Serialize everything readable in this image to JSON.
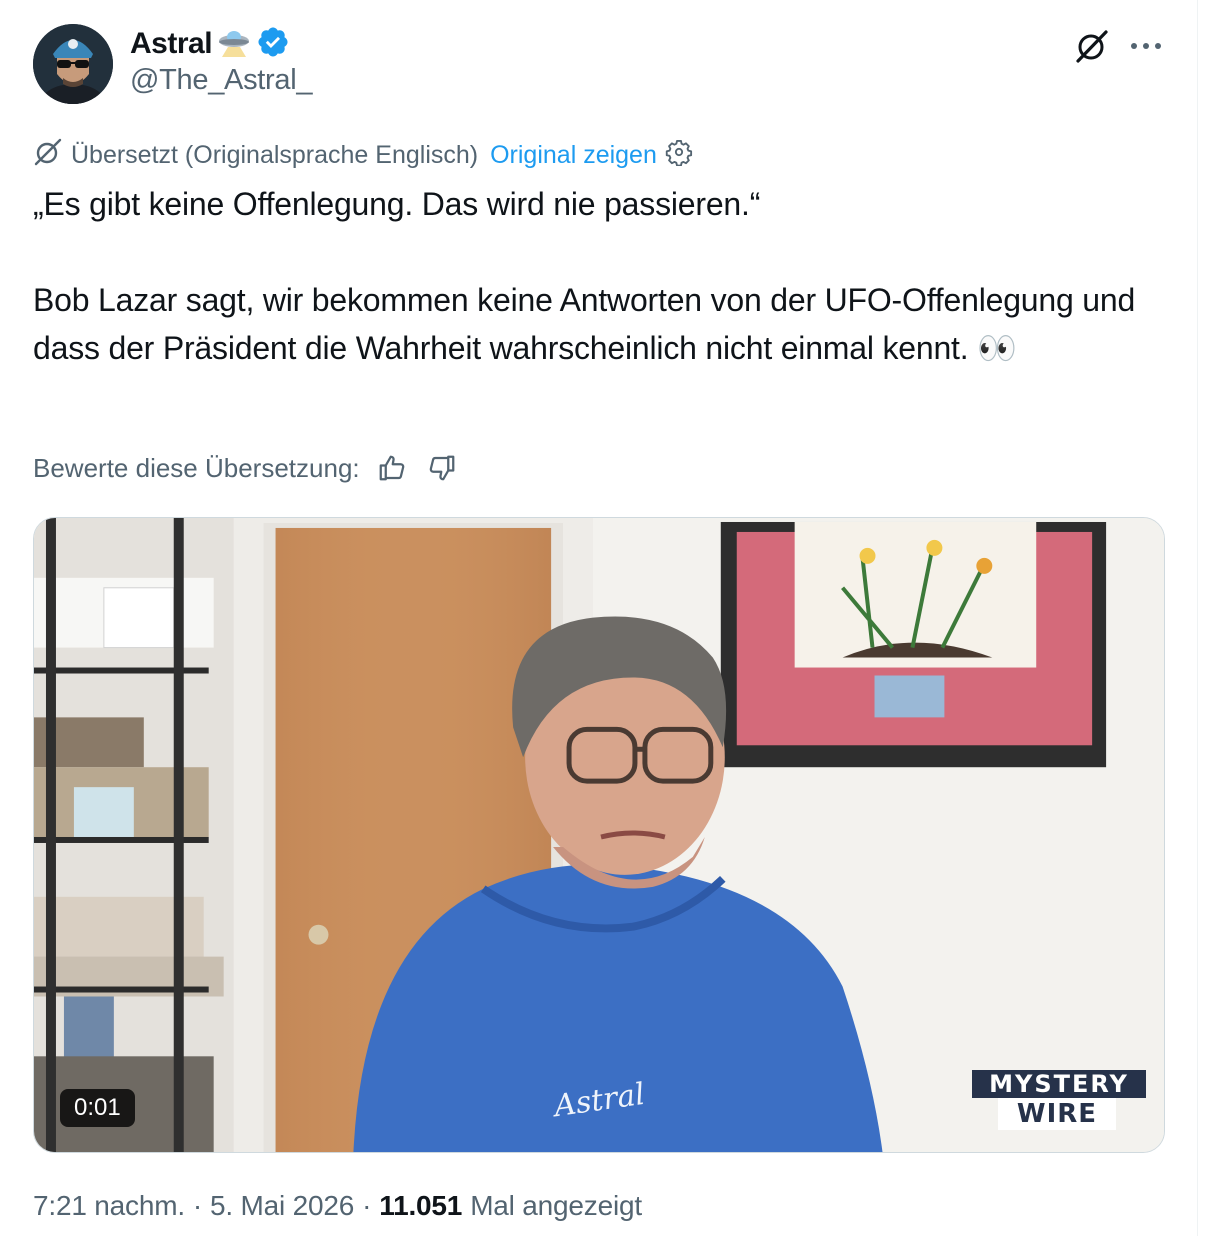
{
  "author": {
    "name": "Astral",
    "name_emoji": "🛸",
    "handle": "@The_Astral_",
    "verified": true,
    "verified_color": "#1d9bf0"
  },
  "header_actions": {
    "grok_icon": "grok-icon",
    "more_icon": "more-icon"
  },
  "translation": {
    "label": "Übersetzt (Originalsprache Englisch)",
    "show_original": "Original zeigen",
    "settings_icon": "gear-icon"
  },
  "tweet": {
    "text": "„Es gibt keine Offenlegung. Das wird nie passieren.“\n\nBob Lazar sagt, wir bekommen keine Antworten von der UFO-Offenlegung und dass der Präsident die Wahrheit wahrscheinlich nicht einmal kennt. 👀"
  },
  "rating": {
    "label": "Bewerte diese Übersetzung:",
    "up_icon": "thumbs-up-icon",
    "down_icon": "thumbs-down-icon"
  },
  "video": {
    "timer": "0:01",
    "watermark": "Astral",
    "logo_top": "MYSTERY",
    "logo_bottom": "WIRE"
  },
  "meta": {
    "time": "7:21 nachm.",
    "separator": "·",
    "date": "5. Mai 2026",
    "separator2": "·",
    "views": "11.051",
    "views_label": "Mal angezeigt"
  },
  "colors": {
    "accent": "#1d9bf0",
    "secondary_text": "#536471",
    "primary_text": "#0f1419"
  }
}
